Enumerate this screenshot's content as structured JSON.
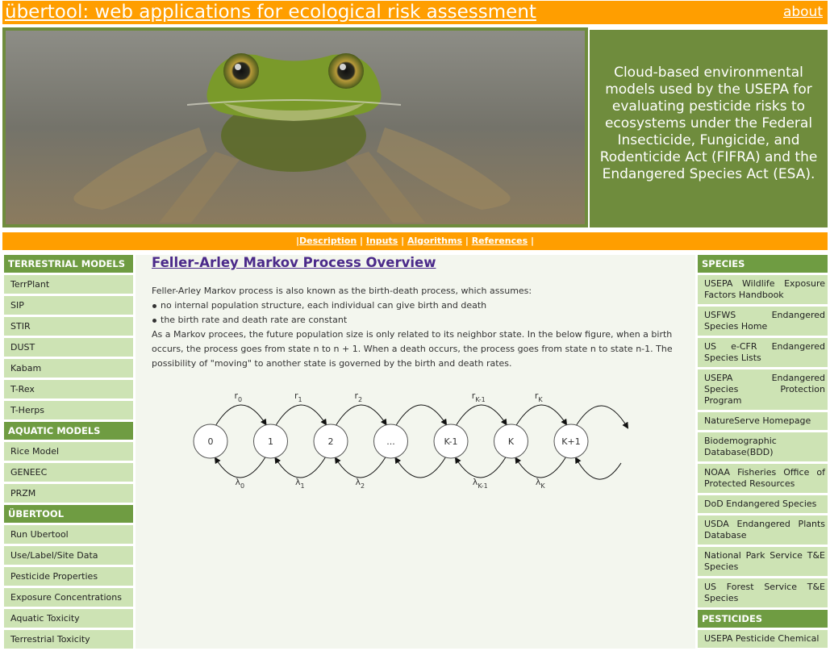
{
  "header": {
    "title": "übertool: web applications for ecological risk assessment",
    "about": "about"
  },
  "banner": {
    "tagline": "Cloud-based environmental models used by the USEPA for evaluating pesticide risks to ecosystems under the Federal Insecticide, Fungicide, and Rodenticide Act (FIFRA) and the Endangered Species Act (ESA)."
  },
  "nav": {
    "description": "Description",
    "inputs": "Inputs",
    "algorithms": "Algorithms",
    "references": "References"
  },
  "left_sidebar": {
    "terrestrial_header": "TERRESTRIAL MODELS",
    "terrestrial": [
      "TerrPlant",
      "SIP",
      "STIR",
      "DUST",
      "Kabam",
      "T-Rex",
      "T-Herps"
    ],
    "aquatic_header": "AQUATIC MODELS",
    "aquatic": [
      "Rice Model",
      "GENEEC",
      "PRZM"
    ],
    "ubertool_header": "ÜBERTOOL",
    "ubertool": [
      "Run Ubertool",
      "Use/Label/Site Data",
      "Pesticide Properties",
      "Exposure Concentrations",
      "Aquatic Toxicity",
      "Terrestrial Toxicity"
    ]
  },
  "right_sidebar": {
    "species_header": "SPECIES",
    "species": [
      "USEPA Wildlife Exposure Factors Handbook",
      "USFWS Endangered Species Home",
      "US e-CFR Endangered Species Lists",
      "USEPA Endangered Species Protection Program",
      "NatureServe Homepage",
      "Biodemographic Database(BDD)",
      "NOAA Fisheries Office of Protected Resources",
      "DoD Endangered Species",
      "USDA Endangered Plants Database",
      "National Park Service T&E Species",
      "US Forest Service T&E Species"
    ],
    "pesticides_header": "PESTICIDES",
    "pesticides": [
      "USEPA Pesticide Chemical"
    ]
  },
  "main": {
    "title": "Feller-Arley Markov Process Overview",
    "intro": "Feller-Arley Markov process is also known as the birth-death process, which assumes:",
    "bullets": [
      "no internal population structure, each individual can give birth and death",
      "the birth rate and death rate are constant"
    ],
    "para": "As a Markov procees, the future population size is only related to its neighbor state. In the below figure, when a birth occurs, the process goes from state n to n + 1. When a death occurs, the process goes from state n to state n-1. The possibility of \"moving\" to another state is governed by the birth and death rates."
  },
  "diagram": {
    "states": [
      "0",
      "1",
      "2",
      "...",
      "K-1",
      "K",
      "K+1"
    ],
    "birth_labels": [
      {
        "base": "r",
        "sub": "0"
      },
      {
        "base": "r",
        "sub": "1"
      },
      {
        "base": "r",
        "sub": "2"
      },
      {
        "base": "r",
        "sub": "K-1"
      },
      {
        "base": "r",
        "sub": "K"
      }
    ],
    "death_labels": [
      {
        "base": "λ",
        "sub": "0"
      },
      {
        "base": "λ",
        "sub": "1"
      },
      {
        "base": "λ",
        "sub": "2"
      },
      {
        "base": "λ",
        "sub": "K-1"
      },
      {
        "base": "λ",
        "sub": "K"
      }
    ]
  },
  "colors": {
    "orange": "#ff9e00",
    "green_dark": "#6f8c3d",
    "green_header": "#6f9c42",
    "green_item": "#cde3b4",
    "title_purple": "#4b2a8a"
  }
}
